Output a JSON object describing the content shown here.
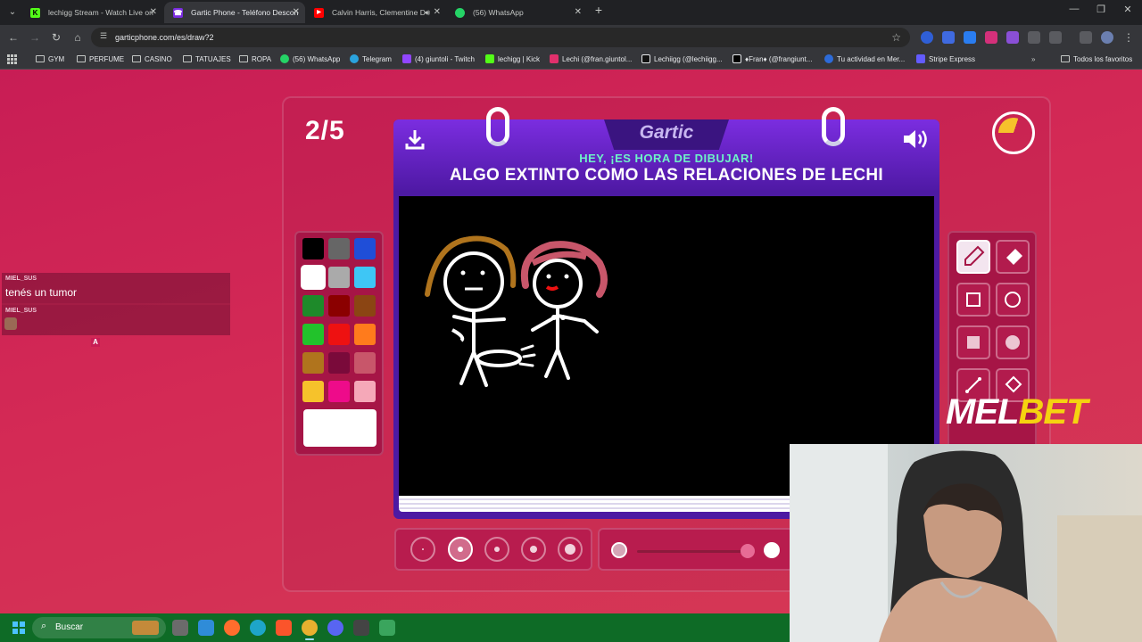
{
  "browser": {
    "tabs": [
      {
        "title": "lechigg Stream - Watch Live on",
        "favicon_color": "#53fc18",
        "favicon": "K",
        "active": false
      },
      {
        "title": "Gartic Phone - Teléfono Descon",
        "favicon_color": "#7b2de0",
        "favicon": "☎",
        "active": true
      },
      {
        "title": "Calvin Harris, Clementine D",
        "favicon_color": "#ff0000",
        "favicon": "▶",
        "active": false
      },
      {
        "title": "(56) WhatsApp",
        "favicon_color": "#25d366",
        "favicon": "✆",
        "active": false
      }
    ],
    "url": "garticphone.com/es/draw?2",
    "bookmarks": [
      {
        "label": "GYM",
        "type": "folder"
      },
      {
        "label": "PERFUME",
        "type": "folder"
      },
      {
        "label": "CASINO",
        "type": "folder"
      },
      {
        "label": "TATUAJES",
        "type": "folder"
      },
      {
        "label": "ROPA",
        "type": "folder"
      },
      {
        "label": "(56) WhatsApp",
        "type": "link",
        "color": "#25d366"
      },
      {
        "label": "Telegram",
        "type": "link",
        "color": "#2aa3de"
      },
      {
        "label": "(4) giuntoli - Twitch",
        "type": "link",
        "color": "#9146ff"
      },
      {
        "label": "lechigg | Kick",
        "type": "link",
        "color": "#53fc18"
      },
      {
        "label": "Lechi (@fran.giuntol...",
        "type": "link",
        "color": "#e1306c"
      },
      {
        "label": "Lechiigg (@lechiigg...",
        "type": "link",
        "color": "#111111"
      },
      {
        "label": "♦Fran♦ (@frangiunt...",
        "type": "link",
        "color": "#000000"
      },
      {
        "label": "Tu actividad en Mer...",
        "type": "link",
        "color": "#2d6bd9"
      },
      {
        "label": "Stripe Express",
        "type": "link",
        "color": "#635bff"
      }
    ],
    "all_bookmarks": "Todos los favoritos"
  },
  "game": {
    "round": "2/5",
    "logo": "Gartic",
    "subtitle": "HEY, ¡ES HORA DE DIBUJAR!",
    "prompt": "ALGO EXTINTO COMO LAS RELACIONES DE LECHI",
    "timer_remaining": 0.3,
    "palette": [
      "#000000",
      "#666666",
      "#1f4ed8",
      "#ffffff",
      "#aaaaaa",
      "#3ec6f5",
      "#1e8a2a",
      "#8b0000",
      "#8b4513",
      "#22c22b",
      "#ee1111",
      "#ff7b1c",
      "#b0741d",
      "#7a0a3a",
      "#c8566a",
      "#f6c22b",
      "#ee0b8a",
      "#f5a8b8"
    ],
    "selected_color": "#ffffff",
    "tools": [
      "pencil",
      "eraser",
      "rectangle-outline",
      "ellipse-outline",
      "rectangle-fill",
      "ellipse-fill",
      "line",
      "fill-bucket"
    ],
    "selected_tool": "pencil",
    "thickness_levels": 5,
    "selected_thickness": 2
  },
  "chat": [
    {
      "user": "MIEL_SUS",
      "text": "tenés un tumor"
    },
    {
      "user": "MIEL_SUS",
      "text": ""
    }
  ],
  "chat_badge": "A",
  "sponsor": {
    "part1": "MEL",
    "part2": "BET"
  },
  "taskbar": {
    "search_label": "Buscar"
  }
}
